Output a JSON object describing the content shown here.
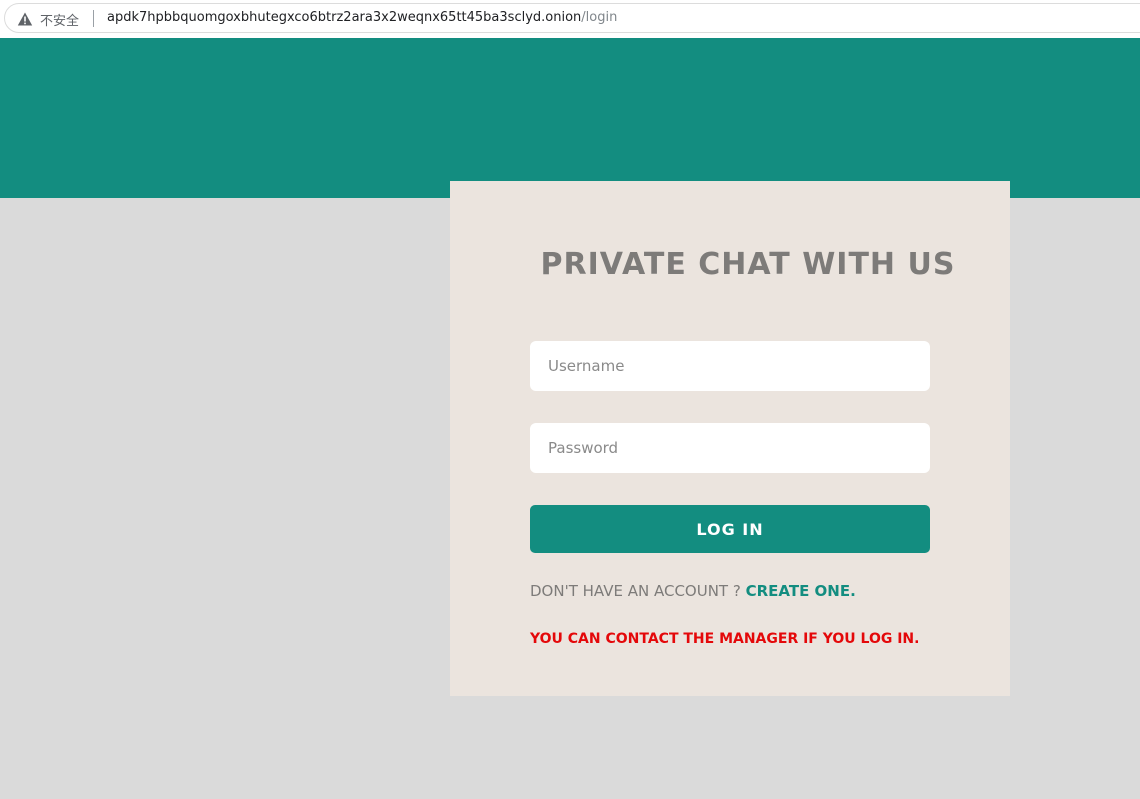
{
  "browser": {
    "security_label": "不安全",
    "url_host": "apdk7hpbbquomgoxbhutegxco6btrz2ara3x2weqnx65tt45ba3sclyd.onion",
    "url_path": "/login",
    "warning_icon": "warning-triangle-icon"
  },
  "login": {
    "title": "PRIVATE CHAT WITH US",
    "username_placeholder": "Username",
    "password_placeholder": "Password",
    "login_button": "LOG IN",
    "no_account_text": "DON'T HAVE AN ACCOUNT ?",
    "create_link": "CREATE ONE.",
    "manager_note": "YOU CAN CONTACT THE MANAGER IF YOU LOG IN."
  },
  "colors": {
    "accent": "#138d80",
    "card_background": "#ebe4de",
    "page_background": "#dadada",
    "warning_text": "#e4080a"
  }
}
